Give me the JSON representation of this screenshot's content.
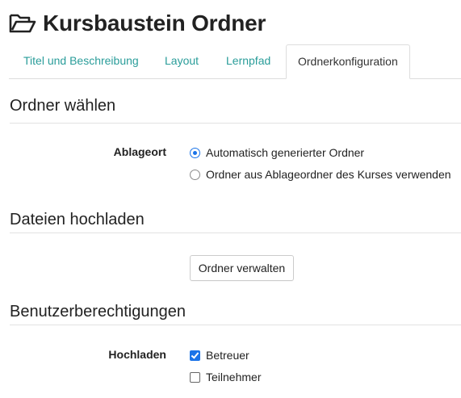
{
  "page": {
    "title": "Kursbaustein Ordner",
    "title_icon": "folder-open-icon"
  },
  "tabs": [
    {
      "label": "Titel und Beschreibung",
      "active": false
    },
    {
      "label": "Layout",
      "active": false
    },
    {
      "label": "Lernpfad",
      "active": false
    },
    {
      "label": "Ordnerkonfiguration",
      "active": true
    }
  ],
  "colors": {
    "tab_link": "#2a9d9a",
    "accent": "#1a73e8"
  },
  "sections": {
    "folder_choice": {
      "title": "Ordner wählen",
      "field_label": "Ablageort",
      "options": [
        {
          "label": "Automatisch generierter Ordner",
          "selected": true
        },
        {
          "label": "Ordner aus Ablageordner des Kurses verwenden",
          "selected": false
        }
      ]
    },
    "upload": {
      "title": "Dateien hochladen",
      "button_label": "Ordner verwalten"
    },
    "permissions": {
      "title": "Benutzerberechtigungen",
      "field_label": "Hochladen",
      "options": [
        {
          "label": "Betreuer",
          "checked": true
        },
        {
          "label": "Teilnehmer",
          "checked": false
        }
      ]
    }
  }
}
